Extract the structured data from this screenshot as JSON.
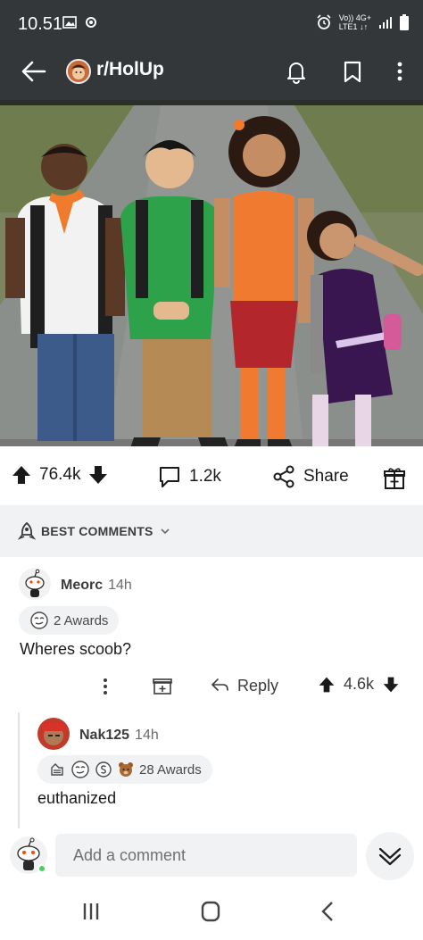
{
  "status_bar": {
    "time": "10.51",
    "net_top": "Vo)) 4G+",
    "net_bottom": "LTE1 ↓↑"
  },
  "header": {
    "subreddit": "r/HolUp",
    "icons": [
      "back-arrow-icon",
      "bell-icon",
      "bookmark-icon",
      "more-vertical-icon"
    ]
  },
  "post": {
    "upvotes": "76.4k",
    "comments": "1.2k",
    "share_label": "Share"
  },
  "sort": {
    "label": "BEST COMMENTS"
  },
  "comments": [
    {
      "user": "Meorc",
      "time": "14h",
      "awards": "2 Awards",
      "body": "Wheres scoob?",
      "reply_label": "Reply",
      "score": "4.6k"
    },
    {
      "user": "Nak125",
      "time": "14h",
      "awards": "28 Awards",
      "body": "euthanized"
    }
  ],
  "composer": {
    "placeholder": "Add a comment"
  },
  "colors": {
    "header_bg": "#34373a",
    "text": "#1a1a1b",
    "muted_bg": "#f1f2f3",
    "online": "#46d160"
  }
}
